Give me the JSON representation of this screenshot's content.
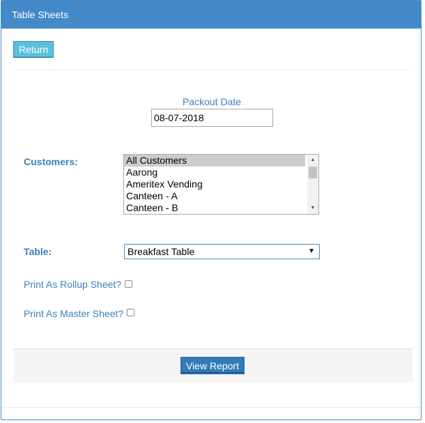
{
  "header": {
    "title": "Table Sheets"
  },
  "toolbar": {
    "return_label": "Return"
  },
  "packout": {
    "label": "Packout Date",
    "value": "08-07-2018"
  },
  "customers": {
    "label": "Customers:",
    "items": [
      "All Customers",
      "Aarong",
      "Ameritex Vending",
      "Canteen - A",
      "Canteen - B"
    ],
    "selected_index": 0
  },
  "table": {
    "label": "Table:",
    "selected": "Breakfast Table"
  },
  "options": {
    "rollup_label": "Print As Rollup Sheet?",
    "rollup_checked": false,
    "master_label": "Print As Master Sheet?",
    "master_checked": false
  },
  "footer": {
    "view_report_label": "View Report"
  },
  "colors": {
    "header_bg": "#4489c8",
    "label_blue": "#3c7ebf",
    "return_bg": "#5bc0de",
    "primary_btn": "#337ab7"
  },
  "icons": {
    "select_arrow": "caret-down-icon",
    "scroll_up": "scroll-up-arrow-icon",
    "scroll_down": "scroll-down-arrow-icon"
  }
}
